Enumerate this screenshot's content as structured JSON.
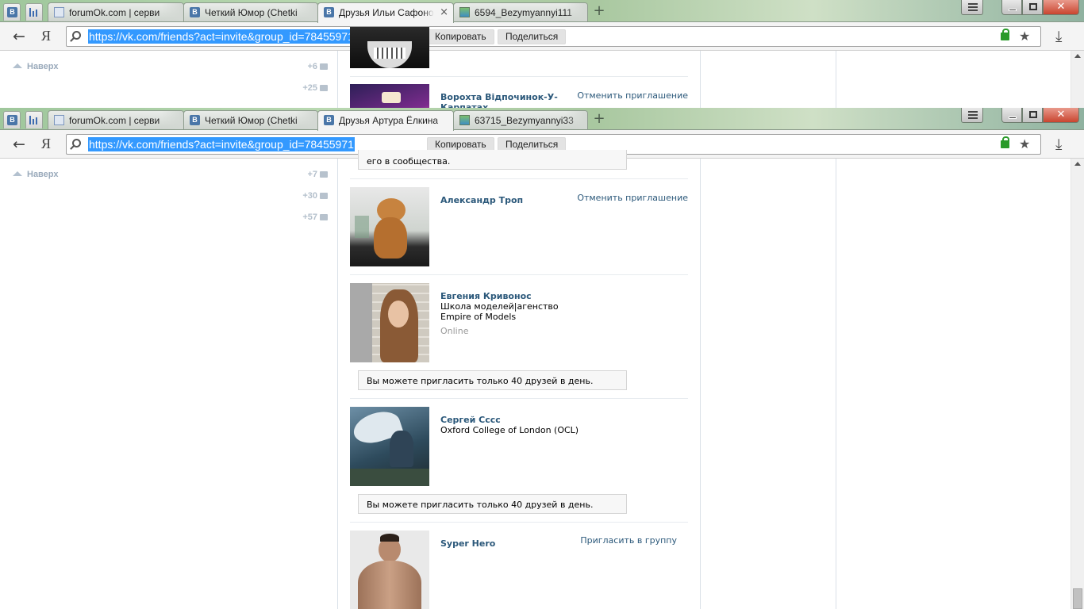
{
  "back_window": {
    "tabs": [
      {
        "title": "forumOk.com | серви",
        "icon": "chart-favicon"
      },
      {
        "title": "Четкий Юмор (Chetki",
        "icon": "vk-favicon"
      },
      {
        "title": "Друзья Ильи Сафоно",
        "icon": "vk-favicon",
        "active": true
      },
      {
        "title": "6594_Bezymyannyi111",
        "icon": "image-favicon"
      }
    ],
    "pinned": [
      "В"
    ],
    "toolbar": {
      "back_glyph": "←",
      "ya_label": "Я",
      "url": "https://vk.com/friends?act=invite&group_id=78455971",
      "copy_label": "Копировать",
      "share_label": "Поделиться",
      "star_glyph": "★",
      "download_glyph": "⤓"
    },
    "sidebar": {
      "back_to_top": "Наверх",
      "counters": [
        "+6",
        "+25"
      ]
    },
    "friends": [
      {
        "name": "Ворохта Відпочинок-У-Карпатах",
        "action": "Отменить приглашение"
      }
    ]
  },
  "front_window": {
    "tabs": [
      {
        "title": "forumOk.com | серви",
        "icon": "chart-favicon"
      },
      {
        "title": "Четкий Юмор (Chetki",
        "icon": "vk-favicon"
      },
      {
        "title": "Друзья Артура Ёлкина",
        "icon": "vk-favicon",
        "active": true
      },
      {
        "title": "63715_Bezymyannyi33",
        "icon": "image-favicon"
      }
    ],
    "pinned": [
      "В"
    ],
    "window_controls": {
      "close_glyph": "✕"
    },
    "toolbar": {
      "back_glyph": "←",
      "ya_label": "Я",
      "url": "https://vk.com/friends?act=invite&group_id=78455971",
      "copy_label": "Копировать",
      "share_label": "Поделиться",
      "star_glyph": "★",
      "download_glyph": "⤓"
    },
    "sidebar": {
      "back_to_top": "Наверх",
      "counters": [
        "+7",
        "+30",
        "+57"
      ]
    },
    "partial_notice": "его в сообщества.",
    "friends": [
      {
        "name": "Александр Троп",
        "action": "Отменить приглашение"
      },
      {
        "name": "Евгения Кривонос",
        "subtitle": "Школа моделей|агенство Empire of Models",
        "status": "Online",
        "notice": "Вы можете пригласить только 40 друзей в день."
      },
      {
        "name": "Сергей Сссс",
        "subtitle": "Oxford College of London (OCL)",
        "notice": "Вы можете пригласить только 40 друзей в день."
      },
      {
        "name": "Syper Hero",
        "action": "Пригласить в группу"
      }
    ]
  },
  "colors": {
    "vk_link": "#2b587a",
    "vk_blue": "#4a76a8",
    "url_selection": "#3399ff",
    "close_red": "#c9452f",
    "lock_green": "#2a9a2a"
  }
}
